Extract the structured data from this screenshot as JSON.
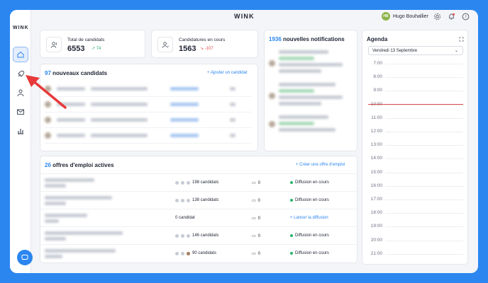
{
  "brand": "WINK",
  "sidebar": {
    "logo": "WINK",
    "items": [
      {
        "icon": "home-icon",
        "active": true
      },
      {
        "icon": "rocket-icon",
        "active": false
      },
      {
        "icon": "user-icon",
        "active": false
      },
      {
        "icon": "mail-icon",
        "active": false
      },
      {
        "icon": "bar-chart-icon",
        "active": false
      }
    ]
  },
  "header": {
    "user_initials": "HB",
    "user_name": "Hugo Bouhallier",
    "icons": [
      "gear-icon",
      "bell-icon",
      "help-icon"
    ]
  },
  "stats": {
    "total": {
      "label": "Total de candidats",
      "value": "6553",
      "delta": "74",
      "trend": "up"
    },
    "ongoing": {
      "label": "Candidatures en cours",
      "value": "1563",
      "delta": "-107",
      "trend": "down"
    }
  },
  "notifications": {
    "count": "1936",
    "title": "nouvelles notifications"
  },
  "new_candidates": {
    "count": "97",
    "title": "nouveaux candidats",
    "add_link": "+ Ajouter un candidat"
  },
  "jobs": {
    "count": "26",
    "title": "offres d'emploi actives",
    "create_link": "+ Créer une offre d'emploi",
    "rows": [
      {
        "candidates": "198 candidats",
        "messages": "0",
        "status": "Diffusion en cours",
        "diffusing": true
      },
      {
        "candidates": "138 candidats",
        "messages": "0",
        "status": "Diffusion en cours",
        "diffusing": true
      },
      {
        "candidates": "0 candidat",
        "messages": "0",
        "status": "+ Lancer la diffusion",
        "diffusing": false
      },
      {
        "candidates": "146 candidats",
        "messages": "0",
        "status": "Diffusion en cours",
        "diffusing": true
      },
      {
        "candidates": "90 candidats",
        "messages": "0",
        "status": "Diffusion en cours",
        "diffusing": true
      }
    ]
  },
  "agenda": {
    "title": "Agenda",
    "date": "Vendredi 13 Septembre",
    "hours": [
      "7:00",
      "8:00",
      "9:00",
      "10:00",
      "11:00",
      "12:00",
      "13:00",
      "14:00",
      "15:00",
      "16:00",
      "17:00",
      "18:00",
      "19:00",
      "20:00",
      "21:00"
    ]
  },
  "colors": {
    "accent": "#2b86f0",
    "up": "#29b36a",
    "down": "#e04b4b"
  }
}
